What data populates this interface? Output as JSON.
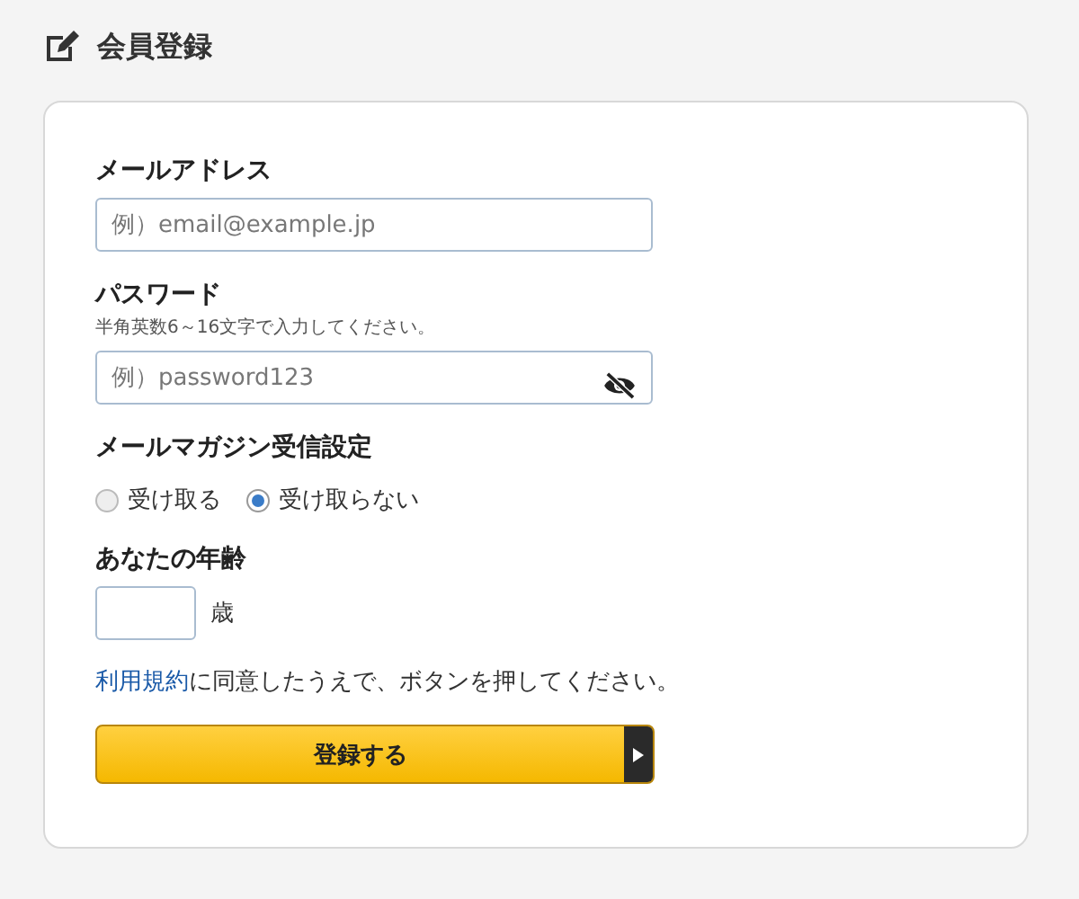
{
  "page_title": "会員登録",
  "email": {
    "label": "メールアドレス",
    "placeholder": "例）email@example.jp"
  },
  "password": {
    "label": "パスワード",
    "hint": "半角英数6～16文字で入力してください。",
    "placeholder": "例）password123"
  },
  "newsletter": {
    "label": "メールマガジン受信設定",
    "options": [
      {
        "label": "受け取る",
        "selected": false
      },
      {
        "label": "受け取らない",
        "selected": true
      }
    ]
  },
  "age": {
    "label": "あなたの年齢",
    "unit": "歳"
  },
  "terms": {
    "link": "利用規約",
    "text": "に同意したうえで、ボタンを押してください。"
  },
  "submit": {
    "label": "登録する"
  }
}
